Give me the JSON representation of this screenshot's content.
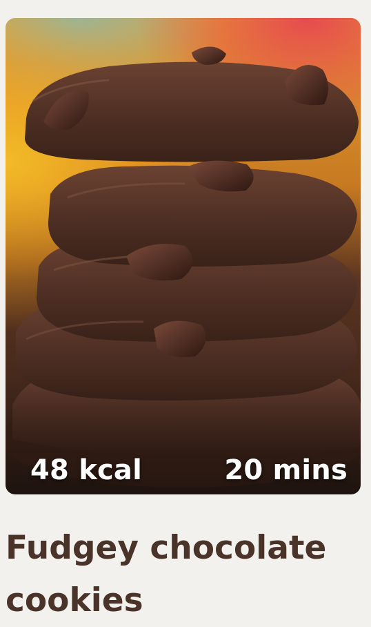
{
  "recipe": {
    "calories": "48 kcal",
    "time": "20 mins",
    "title": "Fudgey chocolate cookies"
  },
  "colors": {
    "background": "#f3f1ee",
    "title_text": "#4a3328",
    "overlay_text": "#ffffff"
  },
  "image": {
    "icon": "cookie-stack-photo"
  }
}
